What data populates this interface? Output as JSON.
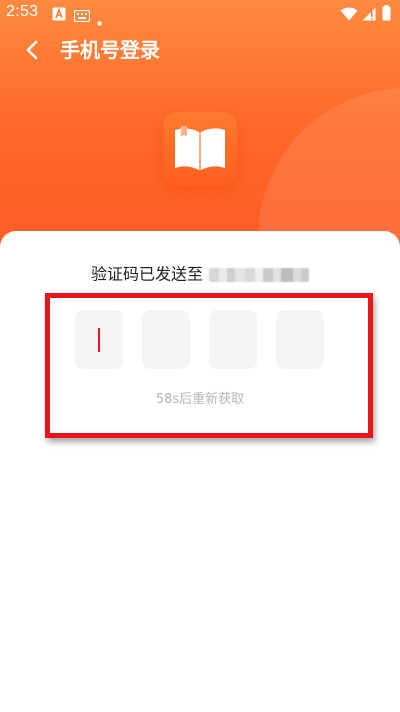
{
  "status_bar": {
    "time": "2:53",
    "icons": [
      "a-box-icon",
      "keyboard-icon",
      "dot-icon",
      "wifi-icon",
      "signal-icon",
      "battery-icon"
    ]
  },
  "nav": {
    "back_icon": "chevron-left-icon",
    "title": "手机号登录"
  },
  "logo": {
    "icon": "open-book-icon"
  },
  "verification": {
    "sent_label": "验证码已发送至",
    "code_boxes": [
      "",
      "",
      "",
      ""
    ],
    "focused_index": 0,
    "resend_text": "58s后重新获取"
  },
  "colors": {
    "header_gradient_top": "#ff8a40",
    "header_gradient_bottom": "#ff5a24",
    "accent_red": "#e8161b",
    "code_box_bg": "#f5f5f5",
    "resend_text": "#b5b5b5"
  }
}
